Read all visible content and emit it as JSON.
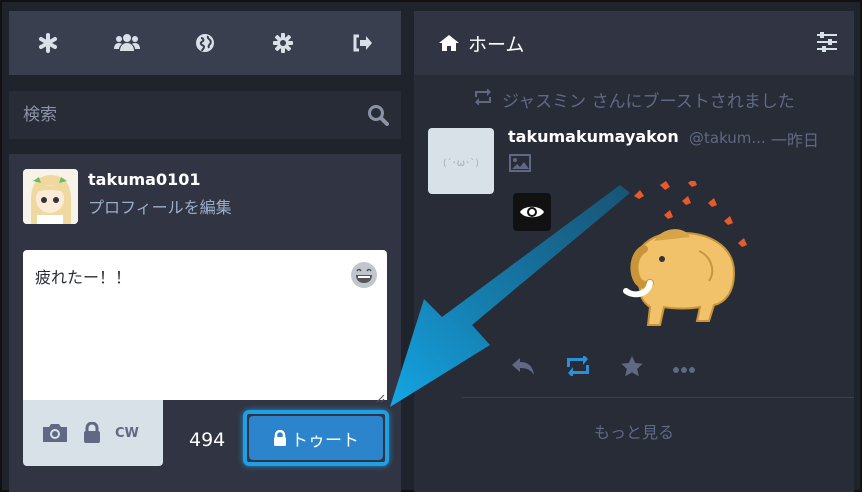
{
  "nav": {
    "icons": [
      "asterisk-icon",
      "users-icon",
      "globe-icon",
      "gear-icon",
      "sign-out-icon"
    ]
  },
  "search": {
    "placeholder": "検索"
  },
  "compose": {
    "username": "takuma0101",
    "edit_profile": "プロフィールを編集",
    "text": "疲れたー！！",
    "cw_label": "CW",
    "char_count": "494",
    "toot_label": "トゥート"
  },
  "home": {
    "title": "ホーム",
    "boost_text": "ジャスミン さんにブーストされました",
    "status": {
      "display_name": "takumakumayakon",
      "acct": "@takum...",
      "time": "一昨日",
      "avatar_text": "(´･ω･`)"
    },
    "load_more": "もっと見る"
  },
  "colors": {
    "accent": "#2b84cc",
    "highlight": "#1ea0e6",
    "boost": "#2b90d9"
  }
}
